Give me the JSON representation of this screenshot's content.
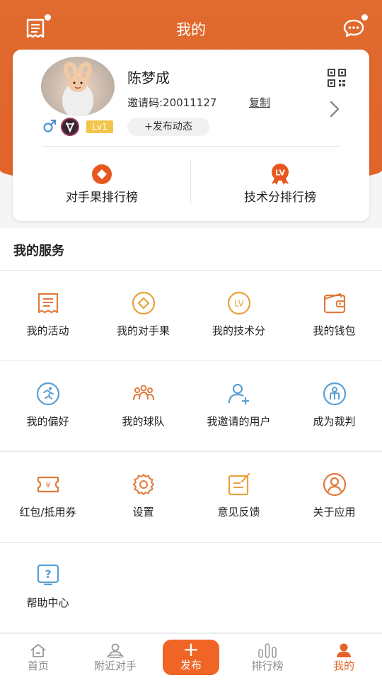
{
  "header": {
    "title": "我的",
    "left_icon": "receipt-icon",
    "right_icon": "chat-bubble-icon"
  },
  "profile": {
    "name": "陈梦成",
    "invite_label": "邀请码:20011127",
    "copy_label": "复制",
    "level": "Lv1",
    "publish_label": "+发布动态",
    "gender": "male"
  },
  "rankings": [
    {
      "label": "对手果排行榜",
      "icon": "diamond-coin-icon"
    },
    {
      "label": "技术分排行榜",
      "icon": "lv-medal-icon"
    }
  ],
  "services": {
    "title": "我的服务",
    "items": [
      {
        "label": "我的活动",
        "icon": "receipt-icon"
      },
      {
        "label": "我的对手果",
        "icon": "diamond-coin-icon"
      },
      {
        "label": "我的技术分",
        "icon": "lv-icon"
      },
      {
        "label": "我的钱包",
        "icon": "wallet-icon"
      },
      {
        "label": "我的偏好",
        "icon": "running-icon"
      },
      {
        "label": "我的球队",
        "icon": "team-icon"
      },
      {
        "label": "我邀请的用户",
        "icon": "add-user-icon"
      },
      {
        "label": "成为裁判",
        "icon": "referee-icon"
      },
      {
        "label": "红包/抵用券",
        "icon": "voucher-icon"
      },
      {
        "label": "设置",
        "icon": "gear-icon"
      },
      {
        "label": "意见反馈",
        "icon": "feedback-icon"
      },
      {
        "label": "关于应用",
        "icon": "user-circle-icon"
      },
      {
        "label": "帮助中心",
        "icon": "help-icon"
      }
    ]
  },
  "bottom_nav": {
    "items": [
      {
        "label": "首页",
        "icon": "home-icon"
      },
      {
        "label": "附近对手",
        "icon": "nearby-icon"
      },
      {
        "label": "发布",
        "icon": "plus-icon"
      },
      {
        "label": "排行榜",
        "icon": "bars-icon"
      },
      {
        "label": "我的",
        "icon": "profile-icon"
      }
    ],
    "active": "我的"
  },
  "colors": {
    "brand": "#e2642a",
    "publish_button": "#f06425",
    "level_badge": "#f3c54a",
    "icon_orange": "#e07a3c",
    "icon_blue": "#5a9fd4"
  }
}
